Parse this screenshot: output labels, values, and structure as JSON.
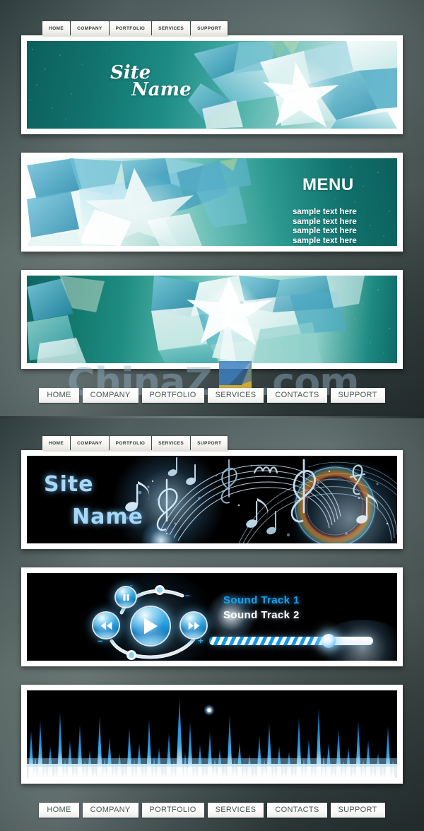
{
  "meta": {
    "watermark": "ChinaZ",
    "watermark_suffix": ".com",
    "watermark_z": "Z"
  },
  "section_teal": {
    "tabs": [
      {
        "label": "HOME"
      },
      {
        "label": "COMPANY"
      },
      {
        "label": "PORTFOLIO"
      },
      {
        "label": "SERVICES"
      },
      {
        "label": "SUPPORT"
      }
    ],
    "banner_header": {
      "site_name_line1": "Site",
      "site_name_line2": "Name"
    },
    "banner_menu": {
      "menu_title": "MENU",
      "items": [
        {
          "label": "sample text here"
        },
        {
          "label": "sample text here"
        },
        {
          "label": "sample text here"
        },
        {
          "label": "sample text here"
        }
      ]
    },
    "navbar": [
      {
        "label": "HOME"
      },
      {
        "label": "COMPANY"
      },
      {
        "label": "PORTFOLIO"
      },
      {
        "label": "SERVICES"
      },
      {
        "label": "CONTACTS"
      },
      {
        "label": "SUPPORT"
      }
    ]
  },
  "section_music": {
    "tabs": [
      {
        "label": "HOME"
      },
      {
        "label": "COMPANY"
      },
      {
        "label": "PORTFOLIO"
      },
      {
        "label": "SERVICES"
      },
      {
        "label": "SUPPORT"
      }
    ],
    "banner_header": {
      "site_name_line1": "Site",
      "site_name_line2": "Name"
    },
    "player": {
      "track_1": "Sound  Track 1",
      "track_2": "Sound  Track 2",
      "progress_percent": 73,
      "minus_label": "–",
      "plus_label": "+",
      "top_minus_label": "–",
      "top_plus_label": "–"
    },
    "navbar": [
      {
        "label": "HOME"
      },
      {
        "label": "COMPANY"
      },
      {
        "label": "PORTFOLIO"
      },
      {
        "label": "SERVICES"
      },
      {
        "label": "CONTACTS"
      },
      {
        "label": "SUPPORT"
      }
    ]
  },
  "colors": {
    "teal_dark": "#0c5f5c",
    "teal_light": "#9bd4cd",
    "accent_blue": "#1aa3f0",
    "music_text": "#a8d8f5",
    "nav_text": "#4a5555",
    "background": "#3d4a4a"
  }
}
